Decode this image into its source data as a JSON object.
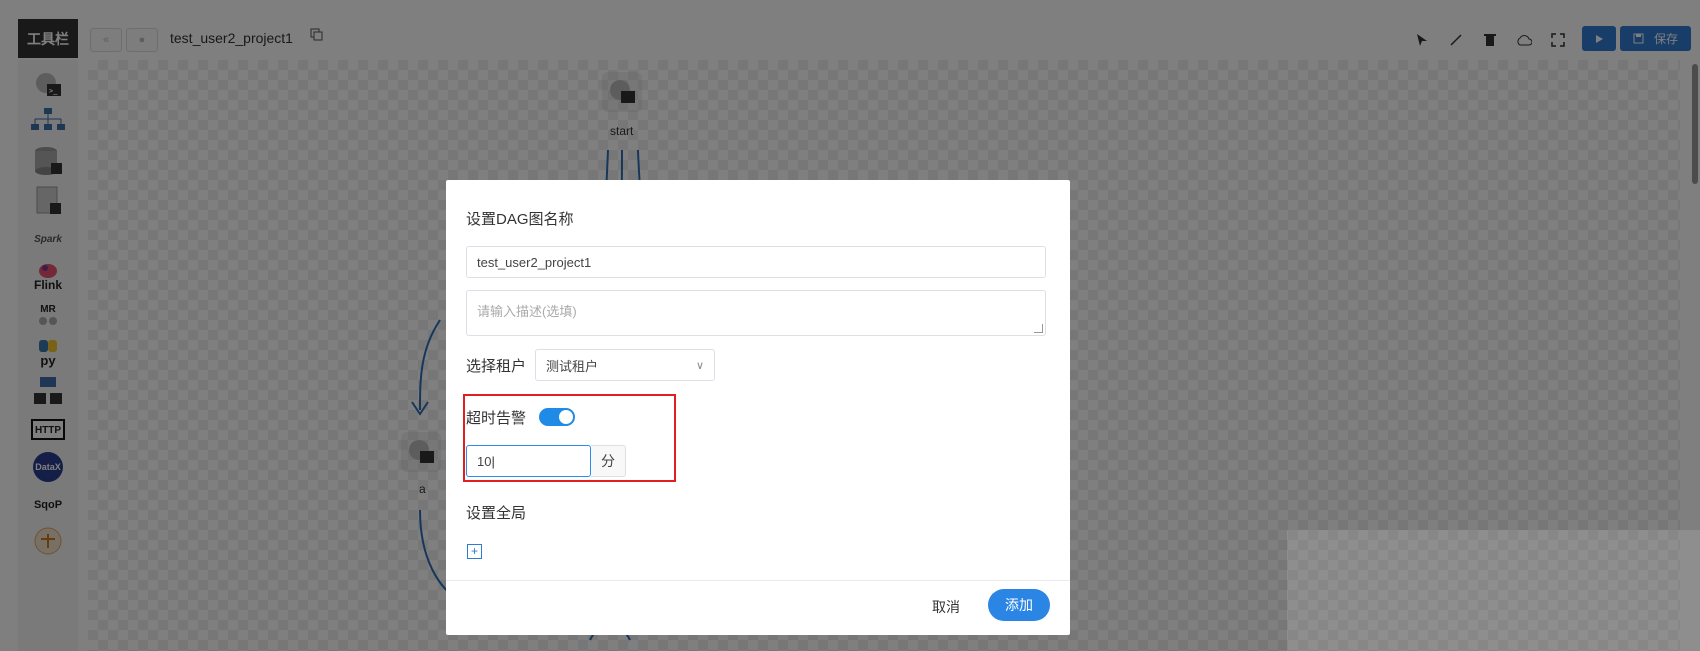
{
  "editor": {
    "toolbar_tab": "工具栏",
    "project_name": "test_user2_project1",
    "save_label": "保存",
    "tools": [
      {
        "name": "shell-tool",
        "icon": "terminal-gear-icon"
      },
      {
        "name": "sub-process-tool",
        "icon": "hierarchy-icon"
      },
      {
        "name": "procedure-tool",
        "icon": "database-icon"
      },
      {
        "name": "sql-tool",
        "icon": "sql-icon"
      },
      {
        "name": "spark-tool",
        "icon": "spark-icon",
        "text": "Spark"
      },
      {
        "name": "flink-tool",
        "icon": "flink-icon",
        "text": "Flink"
      },
      {
        "name": "mr-tool",
        "icon": "mr-icon",
        "text": "MR"
      },
      {
        "name": "python-tool",
        "icon": "python-icon",
        "text": "py"
      },
      {
        "name": "dependent-tool",
        "icon": "dependent-icon"
      },
      {
        "name": "http-tool",
        "icon": "http-icon",
        "text": "HTTP"
      },
      {
        "name": "datax-tool",
        "icon": "datax-icon",
        "text": "DataX"
      },
      {
        "name": "sqoop-tool",
        "icon": "sqoop-icon",
        "text": "SqoP"
      },
      {
        "name": "conditions-tool",
        "icon": "conditions-icon"
      }
    ],
    "nodes": [
      {
        "label": "start"
      },
      {
        "label": "a"
      }
    ]
  },
  "dialog": {
    "title": "设置DAG图名称",
    "name_value": "test_user2_project1",
    "description_placeholder": "请输入描述(选填)",
    "tenant_label": "选择租户",
    "tenant_value": "测试租户",
    "timeout_label": "超时告警",
    "timeout_enabled": true,
    "timeout_value": "10",
    "timeout_unit": "分",
    "global_label": "设置全局",
    "cancel_label": "取消",
    "add_label": "添加"
  },
  "colors": {
    "accent": "#2b85e4",
    "highlight": "#e02020",
    "toolbar_tab": "#333333"
  }
}
